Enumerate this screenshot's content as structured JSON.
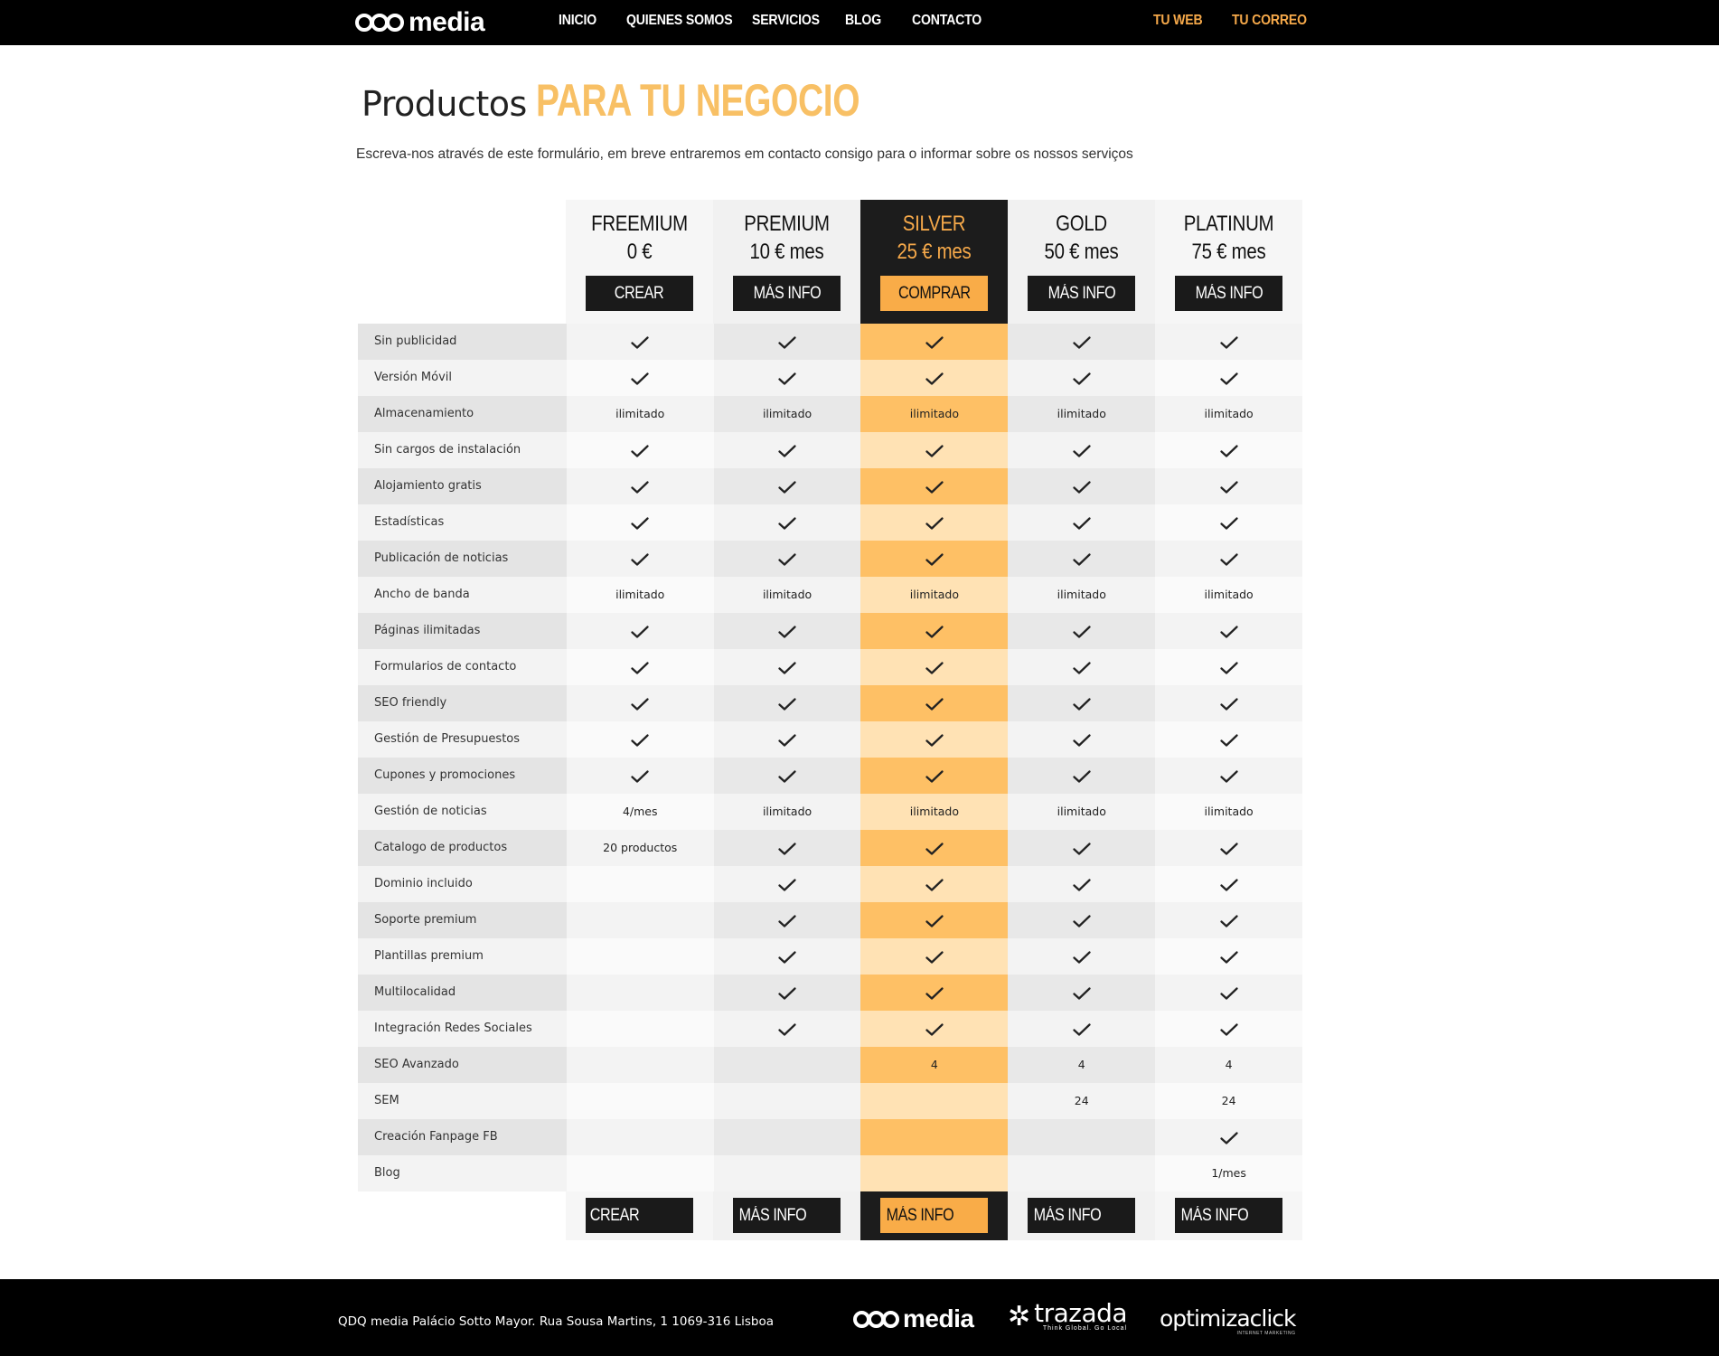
{
  "nav": {
    "logo_text": "media",
    "links": [
      "INICIO",
      "QUIENES SOMOS",
      "SERVICIOS",
      "BLOG",
      "CONTACTO"
    ],
    "accent_links": [
      "TU WEB",
      "TU CORREO"
    ]
  },
  "page": {
    "title_light": "Productos",
    "title_accent": "PARA TU NEGOCIO",
    "intro": "Escreva-nos através de este formulário, em breve entraremos em contacto consigo para o informar sobre os nossos serviços"
  },
  "plans": [
    {
      "name": "FREEMIUM",
      "price": "0 €",
      "button": "CREAR",
      "footer_button": "CREAR"
    },
    {
      "name": "PREMIUM",
      "price": "10 € mes",
      "button": "MÁS INFO",
      "footer_button": "MÁS INFO"
    },
    {
      "name": "SILVER",
      "price": "25 € mes",
      "button": "COMPRAR",
      "footer_button": "MÁS INFO"
    },
    {
      "name": "GOLD",
      "price": "50 € mes",
      "button": "MÁS INFO",
      "footer_button": "MÁS INFO"
    },
    {
      "name": "PLATINUM",
      "price": "75 € mes",
      "button": "MÁS INFO",
      "footer_button": "MÁS INFO"
    }
  ],
  "features": [
    {
      "label": "Sin publicidad",
      "values": [
        "check",
        "check",
        "check",
        "check",
        "check"
      ]
    },
    {
      "label": "Versión Móvil",
      "values": [
        "check",
        "check",
        "check",
        "check",
        "check"
      ]
    },
    {
      "label": "Almacenamiento",
      "values": [
        "ilimitado",
        "ilimitado",
        "ilimitado",
        "ilimitado",
        "ilimitado"
      ]
    },
    {
      "label": "Sin cargos de instalación",
      "values": [
        "check",
        "check",
        "check",
        "check",
        "check"
      ]
    },
    {
      "label": "Alojamiento gratis",
      "values": [
        "check",
        "check",
        "check",
        "check",
        "check"
      ]
    },
    {
      "label": "Estadísticas",
      "values": [
        "check",
        "check",
        "check",
        "check",
        "check"
      ]
    },
    {
      "label": "Publicación de noticias",
      "values": [
        "check",
        "check",
        "check",
        "check",
        "check"
      ]
    },
    {
      "label": "Ancho de banda",
      "values": [
        "ilimitado",
        "ilimitado",
        "ilimitado",
        "ilimitado",
        "ilimitado"
      ]
    },
    {
      "label": "Páginas ilimitadas",
      "values": [
        "check",
        "check",
        "check",
        "check",
        "check"
      ]
    },
    {
      "label": "Formularios de contacto",
      "values": [
        "check",
        "check",
        "check",
        "check",
        "check"
      ]
    },
    {
      "label": "SEO friendly",
      "values": [
        "check",
        "check",
        "check",
        "check",
        "check"
      ]
    },
    {
      "label": "Gestión de Presupuestos",
      "values": [
        "check",
        "check",
        "check",
        "check",
        "check"
      ]
    },
    {
      "label": "Cupones y promociones",
      "values": [
        "check",
        "check",
        "check",
        "check",
        "check"
      ]
    },
    {
      "label": "Gestión de noticias",
      "values": [
        "4/mes",
        "ilimitado",
        "ilimitado",
        "ilimitado",
        "ilimitado"
      ]
    },
    {
      "label": "Catalogo de productos",
      "values": [
        "20 productos",
        "check",
        "check",
        "check",
        "check"
      ]
    },
    {
      "label": "Dominio incluido",
      "values": [
        "",
        "check",
        "check",
        "check",
        "check"
      ]
    },
    {
      "label": "Soporte premium",
      "values": [
        "",
        "check",
        "check",
        "check",
        "check"
      ]
    },
    {
      "label": "Plantillas premium",
      "values": [
        "",
        "check",
        "check",
        "check",
        "check"
      ]
    },
    {
      "label": "Multilocalidad",
      "values": [
        "",
        "check",
        "check",
        "check",
        "check"
      ]
    },
    {
      "label": "Integración Redes Sociales",
      "values": [
        "",
        "check",
        "check",
        "check",
        "check"
      ]
    },
    {
      "label": "SEO Avanzado",
      "values": [
        "",
        "",
        "4",
        "4",
        "4"
      ]
    },
    {
      "label": "SEM",
      "values": [
        "",
        "",
        "",
        "24",
        "24"
      ]
    },
    {
      "label": "Creación Fanpage FB",
      "values": [
        "",
        "",
        "",
        "",
        "check"
      ]
    },
    {
      "label": "Blog",
      "values": [
        "",
        "",
        "",
        "",
        "1/mes"
      ]
    }
  ],
  "footer": {
    "address": "QDQ media Palácio Sotto Mayor. Rua Sousa Martins, 1 1069-316 Lisboa",
    "logo_qdq": "media",
    "logo_trazada": "trazada",
    "logo_trazada_tagline": "Think Global. Go Local",
    "logo_optimiza": "optimizaclick",
    "logo_optimiza_tagline": "INTERNET MARKETING"
  },
  "colors": {
    "accent": "#f6a94a",
    "accent_light": "#ffe2b4",
    "accent_mid": "#fec065",
    "dark": "#1c1c1c"
  }
}
